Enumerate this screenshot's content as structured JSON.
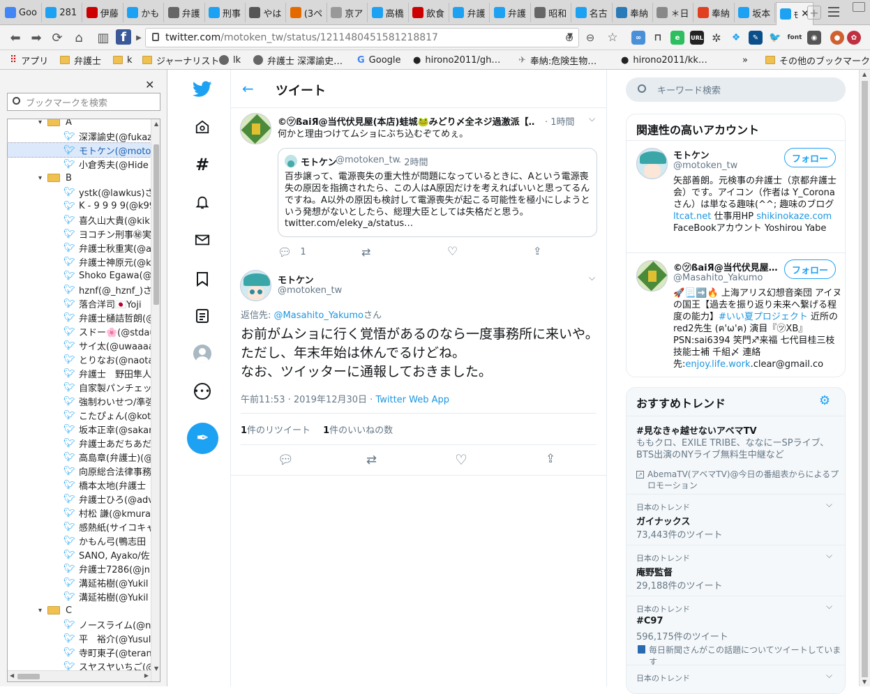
{
  "tabs": [
    {
      "label": "Goo",
      "color": "#4285f4",
      "icon": "google-docs-icon"
    },
    {
      "label": "281",
      "color": "#1da1f2",
      "icon": "twitter-icon"
    },
    {
      "label": "伊藤",
      "color": "#c00",
      "icon": "yahoo-icon"
    },
    {
      "label": "かも",
      "color": "#1da1f2",
      "icon": "twitter-icon"
    },
    {
      "label": "弁護",
      "color": "#666",
      "icon": "globe-icon"
    },
    {
      "label": "刑事",
      "color": "#1da1f2",
      "icon": "twitter-icon"
    },
    {
      "label": "やは",
      "color": "#555",
      "icon": "scales-icon"
    },
    {
      "label": "(3ペ",
      "color": "#e46a00",
      "icon": "page-icon"
    },
    {
      "label": "京ア",
      "color": "#999",
      "icon": "document-icon"
    },
    {
      "label": "高橋",
      "color": "#1da1f2",
      "icon": "twitter-icon"
    },
    {
      "label": "飲食",
      "color": "#c00",
      "icon": "no-icon"
    },
    {
      "label": "弁護",
      "color": "#1da1f2",
      "icon": "twitter-icon"
    },
    {
      "label": "弁護",
      "color": "#1da1f2",
      "icon": "twitter-icon"
    },
    {
      "label": "昭和",
      "color": "#666",
      "icon": "globe-icon"
    },
    {
      "label": "名古",
      "color": "#1da1f2",
      "icon": "twitter-icon"
    },
    {
      "label": "奉納",
      "color": "#2a7ab8",
      "icon": "site-icon"
    },
    {
      "label": "＊日",
      "color": "#888",
      "icon": "bird-icon"
    },
    {
      "label": "奉納",
      "color": "#e04020",
      "icon": "site-icon"
    },
    {
      "label": "坂本",
      "color": "#1da1f2",
      "icon": "twitter-icon"
    },
    {
      "label": "ﾓ",
      "color": "#1da1f2",
      "icon": "twitter-icon"
    }
  ],
  "browser": {
    "url_host": "twitter.com",
    "url_path": "/motoken_tw/status/1211480451581218817"
  },
  "bookmarks_bar": [
    {
      "label": "アプリ",
      "type": "apps"
    },
    {
      "label": "弁護士",
      "type": "folder"
    },
    {
      "label": "k",
      "type": "folder"
    },
    {
      "label": "ジャーナリスト",
      "type": "folder"
    },
    {
      "label": "lk",
      "type": "globe"
    },
    {
      "label": "弁護士 深澤諭史…",
      "type": "globe"
    },
    {
      "label": "Google",
      "type": "google"
    },
    {
      "label": "hirono2011/gh…",
      "type": "github"
    },
    {
      "label": "奉納:危険生物…",
      "type": "bird"
    },
    {
      "label": "hirono2011/kk…",
      "type": "github"
    },
    {
      "label": "»",
      "type": "chevron"
    },
    {
      "label": "その他のブックマーク",
      "type": "folder"
    }
  ],
  "bookmark_sidebar": {
    "search_placeholder": "ブックマークを検索",
    "items": [
      {
        "label": "A",
        "type": "folder",
        "indent": 1
      },
      {
        "label": "深澤諭史(@fukaz",
        "type": "bird",
        "indent": 2
      },
      {
        "label": "モトケン(@motok",
        "type": "bird",
        "indent": 2,
        "selected": true
      },
      {
        "label": "小倉秀夫(@Hide",
        "type": "bird",
        "indent": 2
      },
      {
        "label": "B",
        "type": "folder",
        "indent": 1
      },
      {
        "label": "ystk(@lawkus)さん",
        "type": "bird",
        "indent": 2
      },
      {
        "label": "K - 9 9 9 9(@k99",
        "type": "bird",
        "indent": 2
      },
      {
        "label": "喜久山大貴(@kik",
        "type": "bird",
        "indent": 2
      },
      {
        "label": "ヨコチン刑事㊙実",
        "type": "bird",
        "indent": 2
      },
      {
        "label": "弁護士秋重実(@a",
        "type": "bird",
        "indent": 2
      },
      {
        "label": "弁護士神原元(@k",
        "type": "bird",
        "indent": 2
      },
      {
        "label": "Shoko Egawa(@",
        "type": "bird",
        "indent": 2
      },
      {
        "label": "hznf(@_hznf_)さん",
        "type": "bird",
        "indent": 2
      },
      {
        "label": "落合洋司🇯🇵Yoji",
        "type": "bird",
        "indent": 2
      },
      {
        "label": "弁護士樋詰哲朗(@",
        "type": "bird",
        "indent": 2
      },
      {
        "label": "スドー🌸(@stdau",
        "type": "bird",
        "indent": 2
      },
      {
        "label": "サイ太(@uwaaaa)",
        "type": "bird",
        "indent": 2
      },
      {
        "label": "とりなお(@naotar",
        "type": "bird",
        "indent": 2
      },
      {
        "label": "弁護士　野田隼人",
        "type": "bird",
        "indent": 2
      },
      {
        "label": "自家製パンチェッタ",
        "type": "bird",
        "indent": 2
      },
      {
        "label": "強制わいせつ/準強",
        "type": "bird",
        "indent": 2
      },
      {
        "label": "こたぴょん(@kota",
        "type": "bird",
        "indent": 2
      },
      {
        "label": "坂本正幸(@sakar",
        "type": "bird",
        "indent": 2
      },
      {
        "label": "弁護士あだちあだ",
        "type": "bird",
        "indent": 2
      },
      {
        "label": "高島章(弁護士)(@",
        "type": "bird",
        "indent": 2
      },
      {
        "label": "向原総合法律事務",
        "type": "bird",
        "indent": 2
      },
      {
        "label": "橋本太地(弁護士",
        "type": "bird",
        "indent": 2
      },
      {
        "label": "弁護士ひろ(@adv",
        "type": "bird",
        "indent": 2
      },
      {
        "label": "村松 謙(@kmurar",
        "type": "bird",
        "indent": 2
      },
      {
        "label": "感熱紙(サイコキャ",
        "type": "bird",
        "indent": 2
      },
      {
        "label": "かもん弓(鴨志田",
        "type": "bird",
        "indent": 2
      },
      {
        "label": "SANO, Ayako/佐",
        "type": "bird",
        "indent": 2
      },
      {
        "label": "弁護士7286(@jn",
        "type": "bird",
        "indent": 2
      },
      {
        "label": "溝延祐樹(@Yukil",
        "type": "bird",
        "indent": 2
      },
      {
        "label": "溝延祐樹(@Yukil",
        "type": "bird",
        "indent": 2
      },
      {
        "label": "C",
        "type": "folder",
        "indent": 1
      },
      {
        "label": "ノースライム(@no",
        "type": "bird",
        "indent": 2
      },
      {
        "label": "平　裕介(@Yusul",
        "type": "bird",
        "indent": 2
      },
      {
        "label": "寺町東子(@teran",
        "type": "bird",
        "indent": 2
      },
      {
        "label": "スヤスヤいちご(@",
        "type": "bird",
        "indent": 2
      }
    ]
  },
  "main": {
    "header": "ツイート",
    "parent_tweet": {
      "name": "©㋡ßaiЯ@当代伏見屋(本店)蛙城🐸みどり〆全ネジ過激派【…",
      "time": "· 1時間",
      "text": "何かと理由つけてムショにぶち込むぞてめぇ。",
      "quoted": {
        "name": "モトケン",
        "handle": "@motoken_tw",
        "time": "· 2時間",
        "text": "百歩譲って、電源喪失の重大性が問題になっているときに、Aという電源喪失の原因を指摘されたら、この人はA原因だけを考えればいいと思ってるんですね。A以外の原因も検討して電源喪失が起こる可能性を極小にしようという発想がないとしたら、総理大臣としては失格だと思う。",
        "link": "twitter.com/eleky_a/status…"
      },
      "reply_count": "1"
    },
    "tweet": {
      "name": "モトケン",
      "handle": "@motoken_tw",
      "reply_to_label": "返信先: ",
      "reply_to_user": "@Masahito_Yakumo",
      "reply_to_suffix": "さん",
      "line1": "お前がムショに行く覚悟があるのなら一度事務所に来いや。",
      "line2": "ただし、年末年始は休んでるけどね。",
      "line3": "なお、ツイッターに通報しておきました。",
      "timestamp": "午前11:53 · 2019年12月30日 · ",
      "source": "Twitter Web App",
      "retweets_count": "1",
      "retweets_label": "件のリツイート",
      "likes_count": "1",
      "likes_label": "件のいいねの数"
    }
  },
  "right": {
    "search_placeholder": "キーワード検索",
    "related_title": "関連性の高いアカウント",
    "accounts": [
      {
        "name": "モトケン",
        "handle": "@motoken_tw",
        "follow": "フォロー",
        "bio1": "矢部善朗。元検事の弁護士（京都弁護士会）です。アイコン（作者は Y_Coronaさん）は単なる趣味(^^; 趣味のブログ ",
        "bio_link1": "ltcat.net",
        "bio2": " 仕事用HP ",
        "bio_link2": "shikinokaze.com",
        "bio3": " FaceBookアカウント Yoshirou Yabe"
      },
      {
        "name": "©㋡ßaiЯ@当代伏見屋…",
        "handle": "@Masahito_Yakumo",
        "follow": "フォロー",
        "bio1": "🚀📃➡️🔥 上海アリス幻想音楽団 アイヌの国王【過去を振り返り未来へ繋げる程度の能力】",
        "bio_link1": "#いい夏プロジェクト",
        "bio2": " 近所のred2先生 (ฅ'ω'ฅ) 演目『㋡XB』PSN:sai6394 笑門♐来福 七代目桂三枝 技能士補 千組〆 連絡先:",
        "bio_link2": "enjoy.life.work",
        "bio3": ".clear@gmail.co"
      }
    ],
    "trends_title": "おすすめトレンド",
    "trends": [
      {
        "context": "",
        "title": "#見なきゃ越せないアベマTV",
        "desc": "ももクロ、EXILE TRIBE、ななにーSPライブ、BTS出演のNYライブ無料生中継など",
        "promo": "AbemaTV(アベマTV)@今日の番組表からによるプロモーション"
      },
      {
        "context": "日本のトレンド",
        "title": "ガイナックス",
        "count": "73,443件のツイート"
      },
      {
        "context": "日本のトレンド",
        "title": "庵野監督",
        "count": "29,188件のツイート"
      },
      {
        "context": "日本のトレンド",
        "title": "#C97",
        "count": "596,175件のツイート",
        "note": "毎日新聞さんがこの話題についてツイートしています"
      },
      {
        "context": "日本のトレンド",
        "title": ""
      }
    ]
  },
  "colors": {
    "twitter_blue": "#1da1f2",
    "link": "#1b95e0",
    "muted": "#657786"
  }
}
